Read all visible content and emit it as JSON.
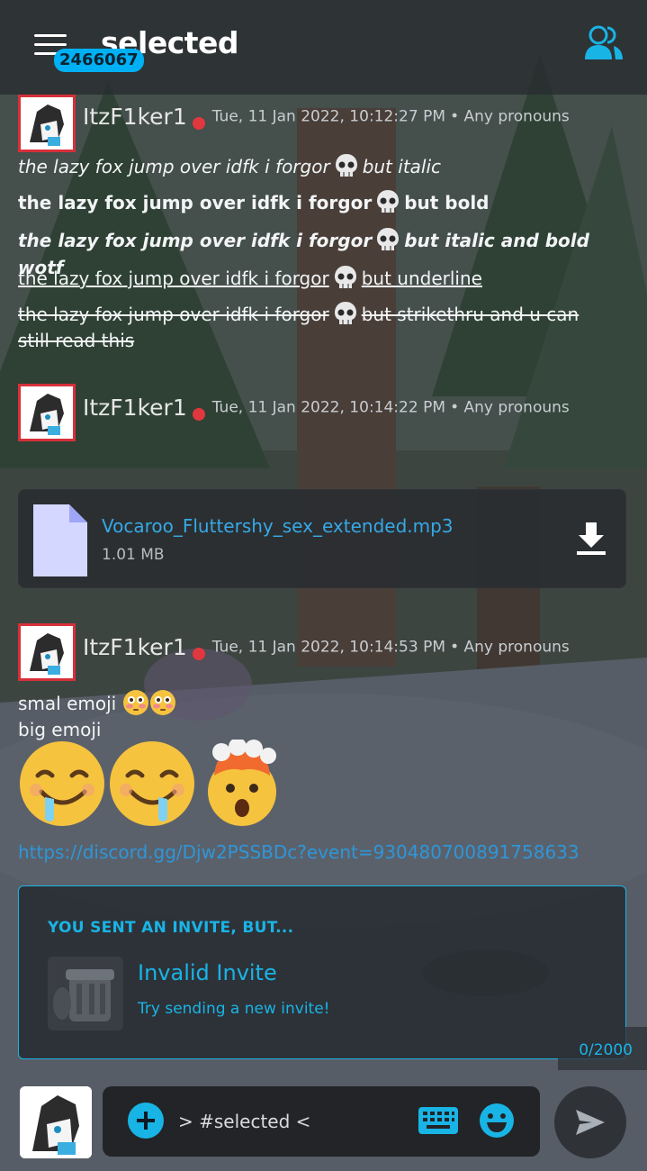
{
  "header": {
    "title": "selected",
    "badge": "2466067"
  },
  "messages": [
    {
      "username": "ItzF1ker1",
      "timestamp": "Tue, 11 Jan 2022, 10:12:27 PM",
      "pronouns": "• Any pronouns",
      "lines": [
        {
          "text": "the lazy fox jump over idfk i forgor",
          "suffix": "but italic"
        },
        {
          "text": "the lazy fox jump over idfk i forgor",
          "suffix": "but bold"
        },
        {
          "text": "the lazy fox jump over idfk i forgor",
          "suffix": "but italic and bold wotf"
        },
        {
          "text": "the lazy fox jump over idfk i forgor",
          "suffix": "but underline"
        },
        {
          "text": "the lazy fox jump over idfk i forgor",
          "suffix": "but strikethru and u can",
          "suffix2": "still read this"
        }
      ]
    },
    {
      "username": "ItzF1ker1",
      "timestamp": "Tue, 11 Jan 2022, 10:14:22 PM",
      "pronouns": "• Any pronouns",
      "attachment": {
        "filename": "Vocaroo_Fluttershy_sex_extended.mp3",
        "size": "1.01 MB"
      }
    },
    {
      "username": "ItzF1ker1",
      "timestamp": "Tue, 11 Jan 2022, 10:14:53 PM",
      "pronouns": "• Any pronouns",
      "line1": "smal emoji",
      "line2": "big emoji",
      "link": "https://discord.gg/Djw2PSSBDc?event=930480700891758633",
      "invite": {
        "heading": "YOU SENT AN INVITE, BUT...",
        "title": "Invalid Invite",
        "subtitle": "Try sending a new invite!"
      }
    }
  ],
  "composer": {
    "char_count": "0/2000",
    "placeholder": "> #selected <"
  },
  "colors": {
    "accent": "#19b4e6",
    "link": "#2e96d8",
    "status_dnd": "#e0383e"
  }
}
